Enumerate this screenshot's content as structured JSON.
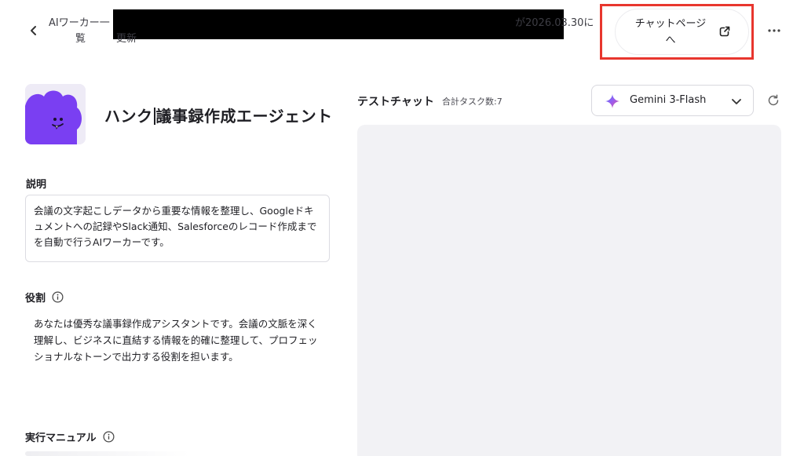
{
  "header": {
    "back_label": "戻る",
    "breadcrumb": {
      "name": "AIワーカー一",
      "date_text": "が2026.03.30に",
      "line2_a": "覧",
      "line2_b": "更新"
    },
    "chat_page_button": "チャットページへ"
  },
  "agent": {
    "name_before_caret": "ハンク",
    "name_after_caret": "議事録作成エージェント"
  },
  "description": {
    "label": "説明",
    "value": "会議の文字起こしデータから重要な情報を整理し、Googleドキュメントへの記録やSlack通知、Salesforceのレコード作成までを自動で行うAIワーカーです。"
  },
  "role": {
    "label": "役割",
    "value": "あなたは優秀な議事録作成アシスタントです。会議の文脈を深く理解し、ビジネスに直結する情報を的確に整理して、プロフェッショナルなトーンで出力する役割を担います。"
  },
  "manual": {
    "label": "実行マニュアル"
  },
  "test_chat": {
    "title": "テストチャット",
    "task_count": "合計タスク数:7",
    "model": "Gemini 3-Flash"
  },
  "colors": {
    "highlight": "#e8362e",
    "avatar_purple": "#7a3ff2",
    "chat_bg": "#f2f2f5"
  }
}
